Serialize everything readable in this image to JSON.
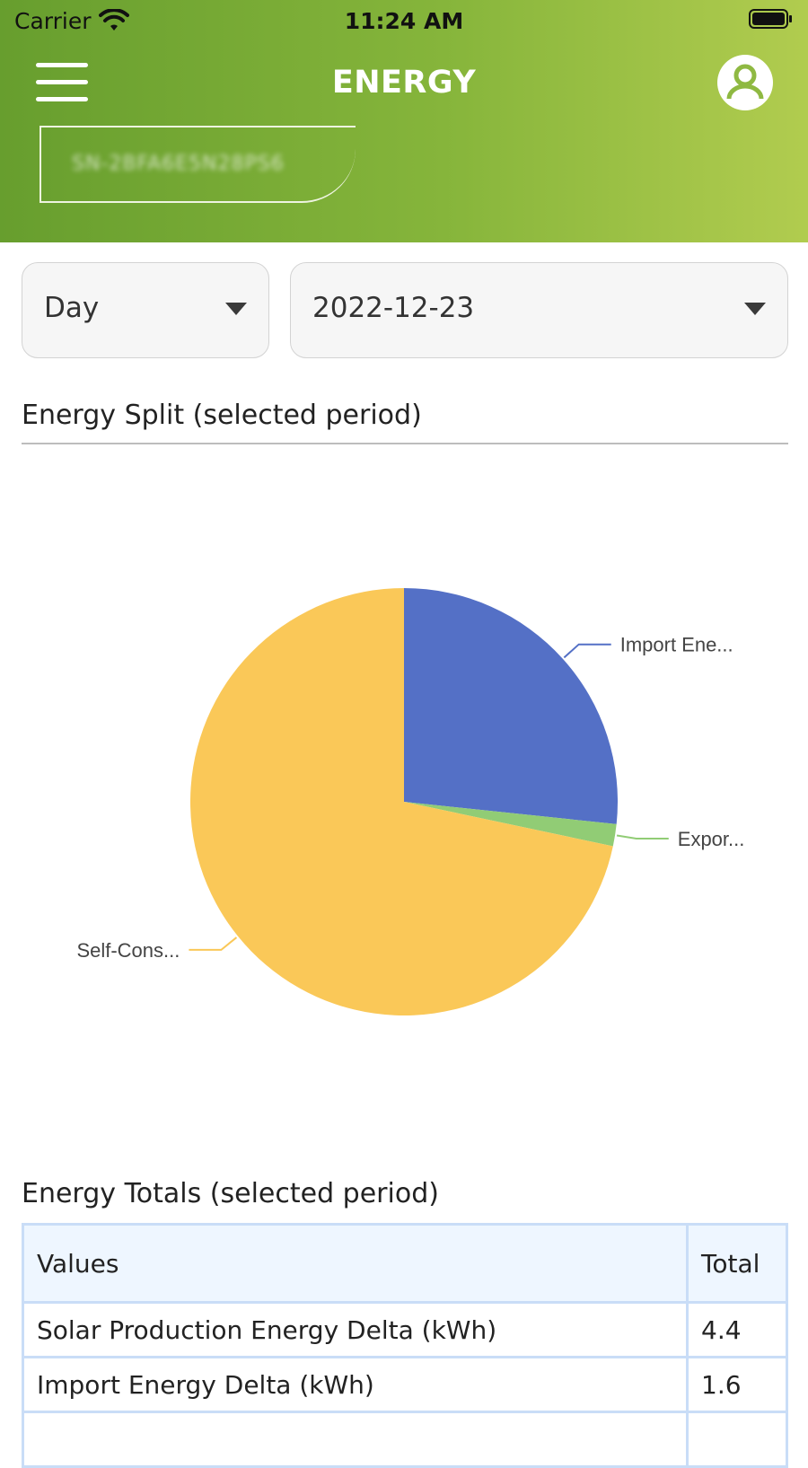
{
  "status_bar": {
    "carrier": "Carrier",
    "time": "11:24 AM"
  },
  "header": {
    "title": "ENERGY",
    "site_id": "SN-2BFA6E5N28PS6"
  },
  "filters": {
    "period": "Day",
    "date": "2022-12-23"
  },
  "energy_split": {
    "title": "Energy Split (selected period)",
    "chart_data": {
      "type": "pie",
      "slices": [
        {
          "label": "Import Ene...",
          "value": 1.6,
          "color": "#5470c6"
        },
        {
          "label": "Expor...",
          "value": 0.1,
          "color": "#91cc75"
        },
        {
          "label": "Self-Cons...",
          "value": 4.3,
          "color": "#fac858"
        }
      ]
    }
  },
  "energy_totals": {
    "title": "Energy Totals (selected period)",
    "columns": [
      "Values",
      "Total"
    ],
    "rows": [
      {
        "label": "Solar Production Energy Delta (kWh)",
        "total": "4.4"
      },
      {
        "label": "Import Energy Delta (kWh)",
        "total": "1.6"
      }
    ]
  }
}
